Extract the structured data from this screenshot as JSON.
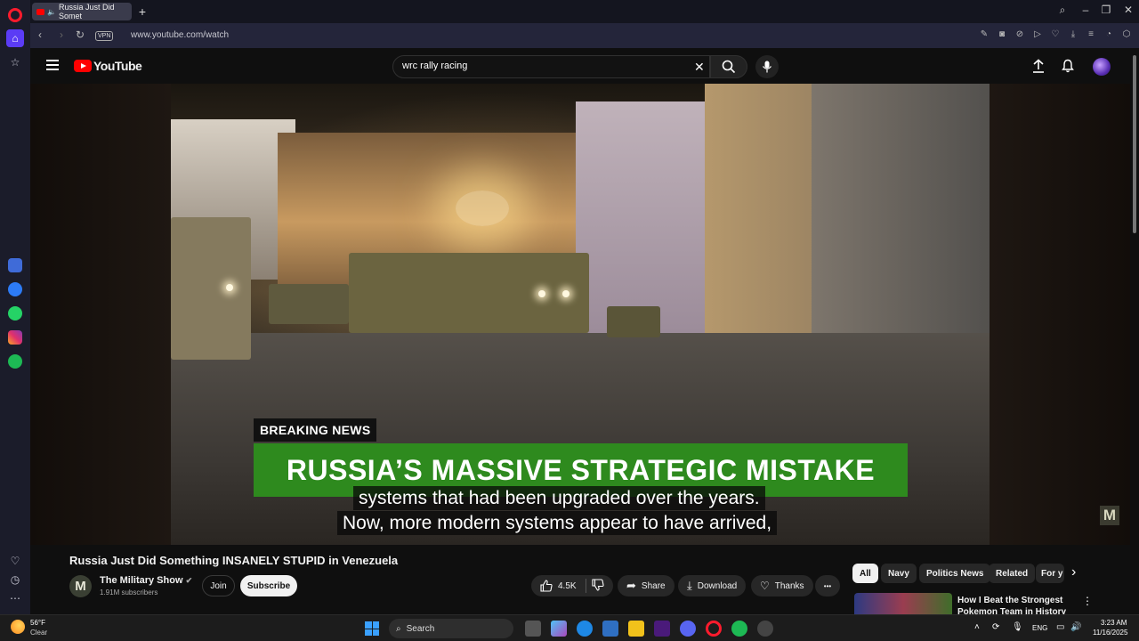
{
  "browser": {
    "tab_title": "Russia Just Did Somet",
    "new_tab_symbol": "+",
    "vpn_label": "VPN",
    "url": "www.youtube.com/watch",
    "accent_color": "#5b3cf5"
  },
  "youtube": {
    "logo_text": "YouTube",
    "search": {
      "value": "wrc rally racing",
      "clear_symbol": "✕"
    }
  },
  "video": {
    "breaking_tag": "BREAKING NEWS",
    "headline": "RUSSIA’S MASSIVE STRATEGIC MISTAKE",
    "captions": [
      "systems that had been upgraded over the years.",
      "Now, more modern systems appear to have arrived,"
    ],
    "watermark": "M",
    "title": "Russia Just Did Something INSANELY STUPID in Venezuela"
  },
  "channel": {
    "avatar_letter": "M",
    "name": "The Military Show",
    "subscribers": "1.91M subscribers",
    "join_label": "Join",
    "subscribe_label": "Subscribe"
  },
  "actions": {
    "likes": "4.5K",
    "share_label": "Share",
    "download_label": "Download",
    "thanks_label": "Thanks",
    "more_symbol": "•••"
  },
  "chips": [
    {
      "label": "All",
      "active": true
    },
    {
      "label": "Navy",
      "active": false
    },
    {
      "label": "Politics News",
      "active": false
    },
    {
      "label": "Related",
      "active": false
    },
    {
      "label": "For y",
      "active": false
    }
  ],
  "recommendation": {
    "title": "How I Beat the Strongest Pokemon Team in History"
  },
  "taskbar": {
    "weather_temp": "56°F",
    "weather_desc": "Clear",
    "search_label": "Search",
    "language": "ENG",
    "time": "3:23 AM",
    "date": "11/16/2025"
  }
}
